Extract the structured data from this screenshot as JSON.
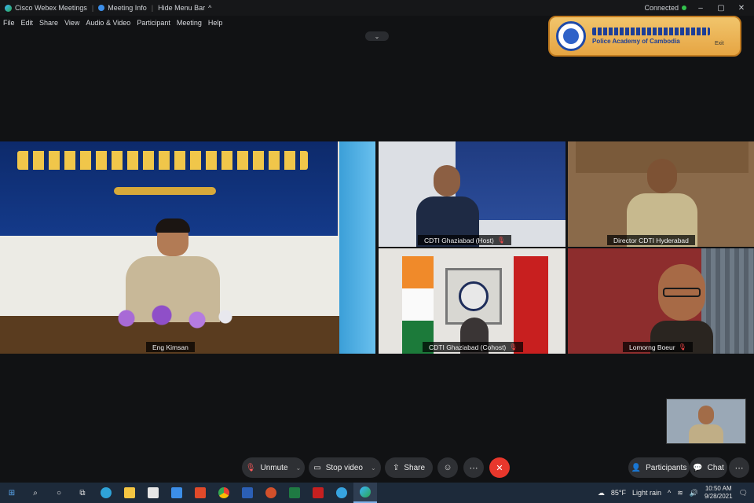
{
  "titlebar": {
    "app_name": "Cisco Webex Meetings",
    "meeting_info": "Meeting Info",
    "hide_menu": "Hide Menu Bar",
    "status": "Connected"
  },
  "menu": [
    "File",
    "Edit",
    "Share",
    "View",
    "Audio & Video",
    "Participant",
    "Meeting",
    "Help"
  ],
  "logo": {
    "subtitle": "Police Academy of Cambodia",
    "exit_hint": "Exit"
  },
  "participants": {
    "main": "Eng Kimsan",
    "host": "CDTI Ghaziabad (Host)",
    "director": "Director CDTI Hyderabad",
    "cohost": "CDTI Ghaziabad (Cohost)",
    "lomorng": "Lomorng Boeur"
  },
  "controls": {
    "unmute": "Unmute",
    "stop_video": "Stop video",
    "share": "Share",
    "participants": "Participants",
    "chat": "Chat"
  },
  "taskbar": {
    "weather_temp": "85°F",
    "weather_desc": "Light rain",
    "time": "10:50 AM",
    "date": "9/28/2021"
  },
  "colors": {
    "end_button": "#e8372c",
    "connected": "#33c24d"
  }
}
